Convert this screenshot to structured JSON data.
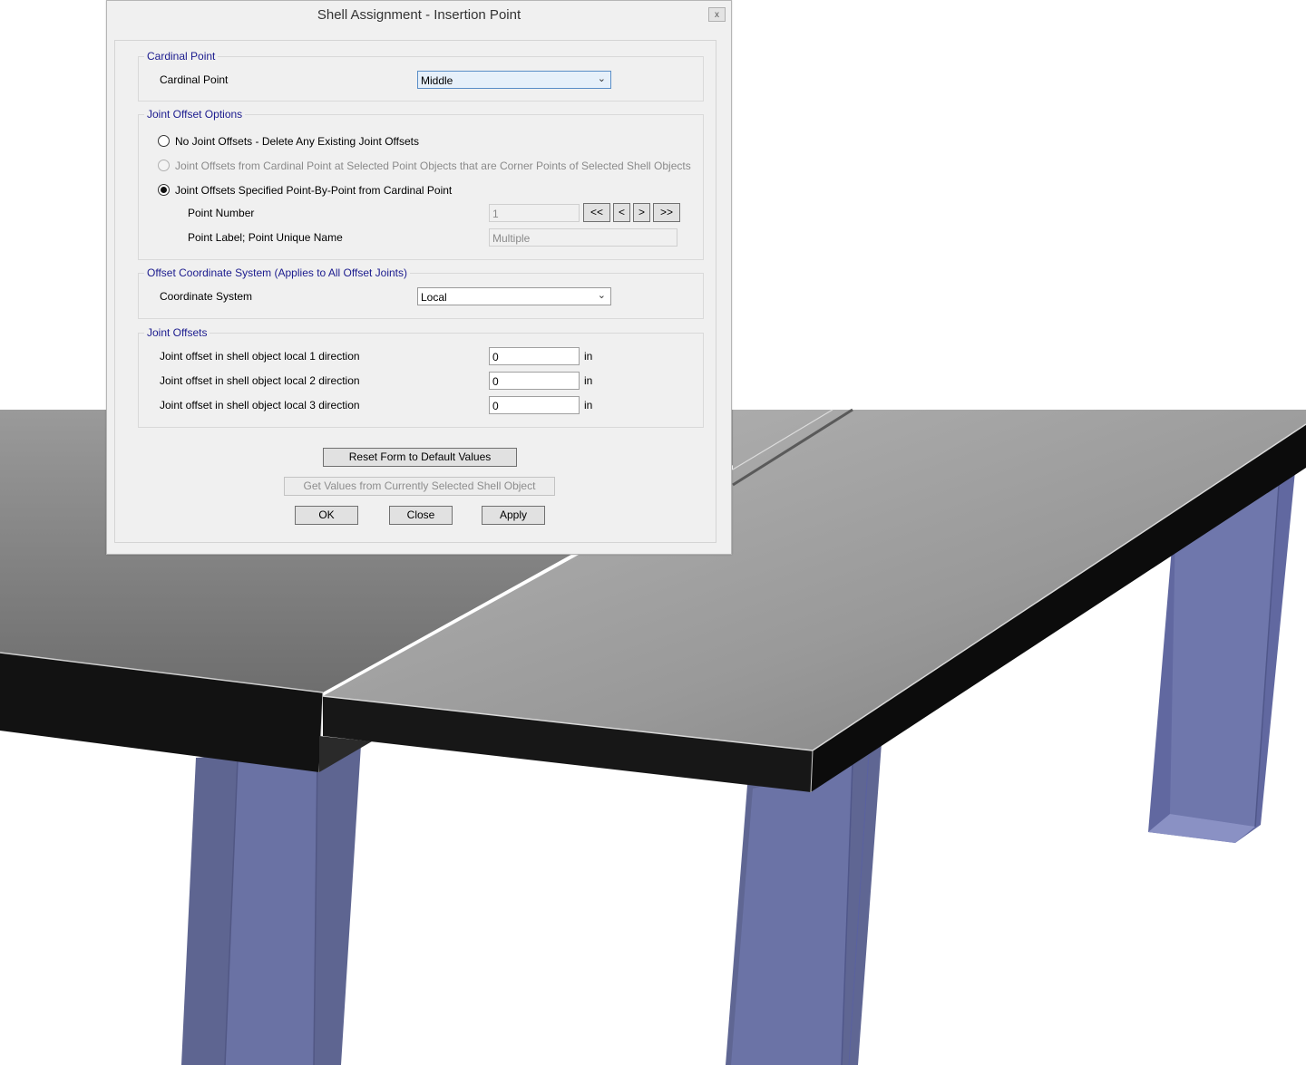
{
  "dialog": {
    "title": "Shell Assignment - Insertion Point",
    "close_glyph": "x"
  },
  "cardinal": {
    "group_title": "Cardinal Point",
    "label": "Cardinal Point",
    "value": "Middle"
  },
  "joint_offset_options": {
    "group_title": "Joint Offset Options",
    "option1": "No Joint Offsets - Delete Any Existing Joint Offsets",
    "option2": "Joint Offsets from Cardinal Point at Selected Point Objects that are Corner Points of Selected Shell Objects",
    "option3": "Joint Offsets Specified Point-By-Point from Cardinal Point",
    "selected_option": 3,
    "point_number_label": "Point Number",
    "point_number_value": "1",
    "nav_first": "<<",
    "nav_prev": "<",
    "nav_next": ">",
    "nav_last": ">>",
    "point_label_label": "Point Label;  Point Unique Name",
    "point_label_value": "Multiple"
  },
  "coord_system": {
    "group_title": "Offset Coordinate System  (Applies to All Offset Joints)",
    "label": "Coordinate System",
    "value": "Local"
  },
  "joint_offsets": {
    "group_title": "Joint Offsets",
    "rows": [
      {
        "label": "Joint offset in shell object local 1 direction",
        "value": "0",
        "unit": "in"
      },
      {
        "label": "Joint offset in shell object local 2 direction",
        "value": "0",
        "unit": "in"
      },
      {
        "label": "Joint offset in shell object local 3 direction",
        "value": "0",
        "unit": "in"
      }
    ]
  },
  "buttons": {
    "reset": "Reset Form to Default Values",
    "get_values": "Get Values from Currently Selected Shell Object",
    "ok": "OK",
    "close": "Close",
    "apply": "Apply"
  },
  "colors": {
    "group_title": "#1b1b8e",
    "column": "#6870a2",
    "slab_top": "#8a8a8a",
    "slab_edge": "#161616"
  },
  "icons": [
    "close-icon",
    "dropdown-arrow-icon"
  ]
}
